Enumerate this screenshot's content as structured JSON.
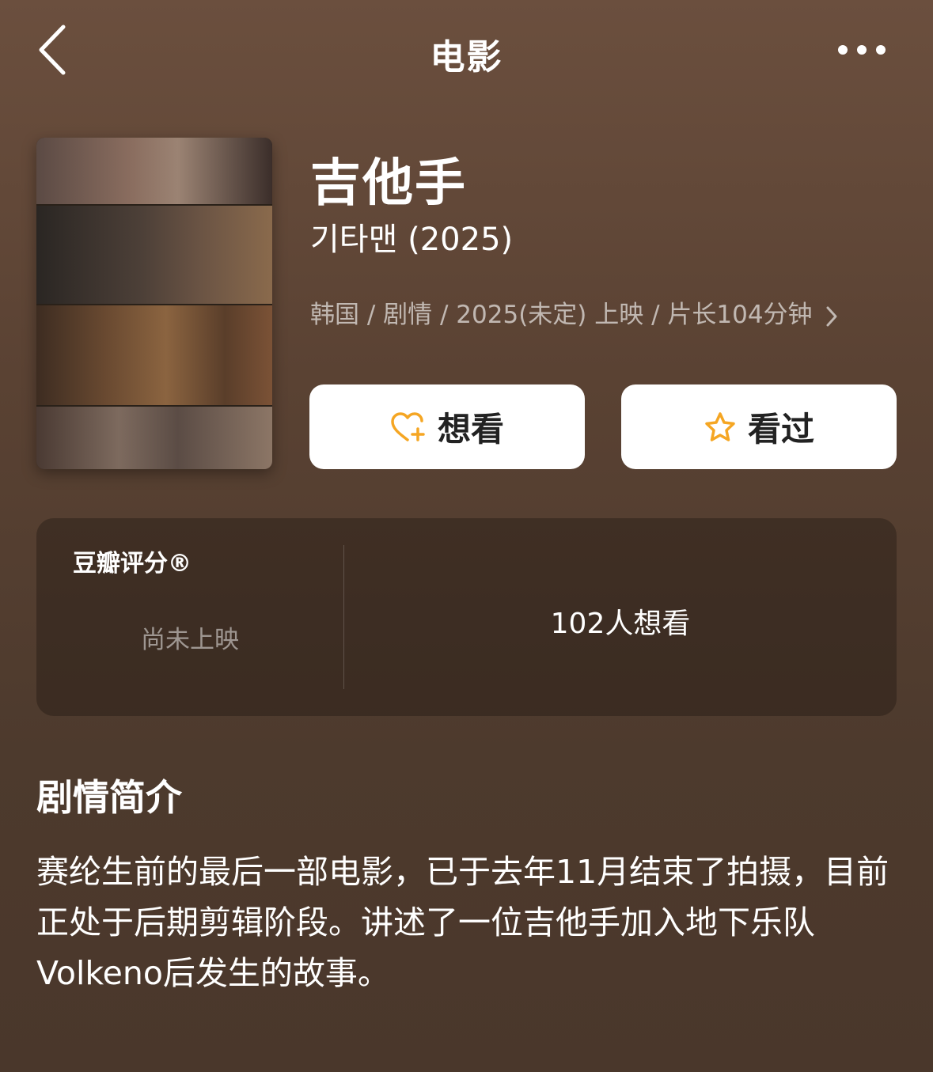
{
  "nav": {
    "title": "电影",
    "back_icon": "chevron-left-icon",
    "more_icon": "more-horizontal-icon"
  },
  "poster": {
    "alt": "吉他手 poster"
  },
  "movie": {
    "title": "吉他手",
    "original_title": "기타맨 (2025)",
    "meta": "韩国 / 剧情 / 2025(未定) 上映 / 片长104分钟"
  },
  "actions": {
    "want_label": "想看",
    "want_icon": "heart-plus-icon",
    "seen_label": "看过",
    "seen_icon": "star-icon",
    "icon_color": "#f5a623"
  },
  "rating": {
    "label": "豆瓣评分®",
    "status": "尚未上映",
    "wish_count": "102人想看"
  },
  "synopsis": {
    "title": "剧情简介",
    "text": "赛纶生前的最后一部电影，已于去年11月结束了拍摄，目前正处于后期剪辑阶段。讲述了一位吉他手加入地下乐队 Volkeno后发生的故事。"
  }
}
